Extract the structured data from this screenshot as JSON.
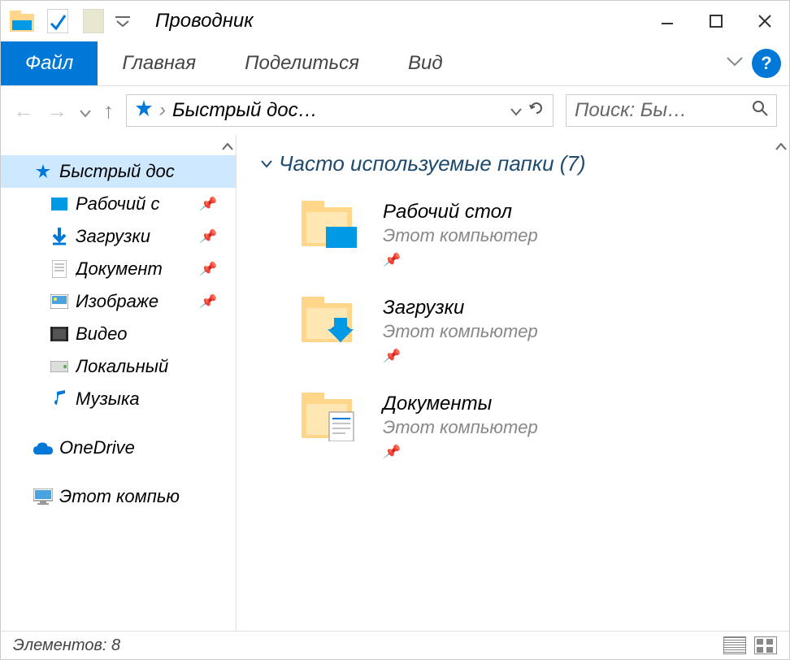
{
  "app_title": "Проводник",
  "ribbon": {
    "file": "Файл",
    "home": "Главная",
    "share": "Поделиться",
    "view": "Вид"
  },
  "address": {
    "crumb": "Быстрый дос…"
  },
  "search": {
    "placeholder": "Поиск: Бы…"
  },
  "sidebar": {
    "quick_access": "Быстрый дос",
    "desktop": "Рабочий с",
    "downloads": "Загрузки",
    "documents": "Документ",
    "pictures": "Изображе",
    "videos": "Видео",
    "local": "Локальный",
    "music": "Музыка",
    "onedrive": "OneDrive",
    "this_pc": "Этот компью"
  },
  "content": {
    "group_header": "Часто используемые папки (7)",
    "folders": [
      {
        "name": "Рабочий стол",
        "sub": "Этот компьютер"
      },
      {
        "name": "Загрузки",
        "sub": "Этот компьютер"
      },
      {
        "name": "Документы",
        "sub": "Этот компьютер"
      }
    ]
  },
  "statusbar": {
    "items": "Элементов: 8"
  }
}
